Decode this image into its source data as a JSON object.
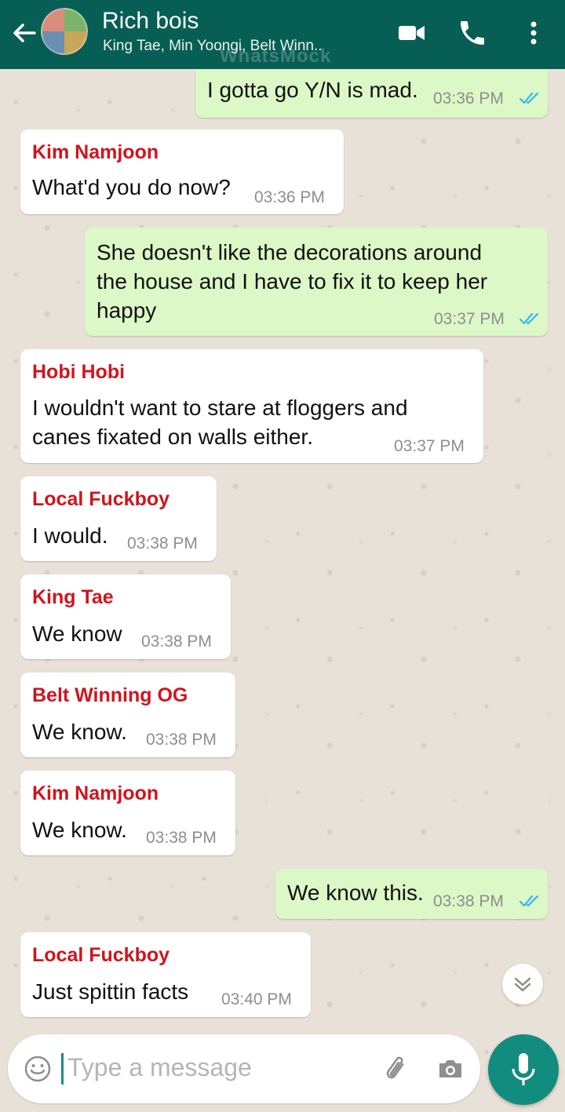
{
  "header": {
    "title": "Rich bois",
    "subtitle": "King Tae, Min Yoongi, Belt Winn..",
    "watermark": "WhatsMock"
  },
  "messages": [
    {
      "dir": "out",
      "text": "I gotta go Y/N is mad.",
      "time": "03:36 PM",
      "read": true
    },
    {
      "dir": "in",
      "sender": "Kim Namjoon",
      "text": "What'd you do now?",
      "time": "03:36 PM"
    },
    {
      "dir": "out",
      "lines": [
        "She doesn't like the decorations around",
        "the house and I have to fix it to keep her",
        "happy"
      ],
      "time": "03:37 PM",
      "read": true
    },
    {
      "dir": "in",
      "sender": "Hobi Hobi",
      "lines": [
        "I wouldn't want to stare at floggers and",
        "canes fixated on walls either."
      ],
      "time": "03:37 PM"
    },
    {
      "dir": "in",
      "sender": "Local Fuckboy",
      "text": "I would.",
      "time": "03:38 PM"
    },
    {
      "dir": "in",
      "sender": "King Tae",
      "text": "We know",
      "time": "03:38 PM"
    },
    {
      "dir": "in",
      "sender": "Belt Winning OG",
      "text": "We know.",
      "time": "03:38 PM"
    },
    {
      "dir": "in",
      "sender": "Kim Namjoon",
      "text": "We know.",
      "time": "03:38 PM"
    },
    {
      "dir": "out",
      "text": "We know this.",
      "time": "03:38 PM",
      "read": true
    },
    {
      "dir": "in",
      "sender": "Local Fuckboy",
      "text": "Just spittin facts",
      "time": "03:40 PM"
    }
  ],
  "composer": {
    "placeholder": "Type a message"
  },
  "colors": {
    "header": "#075e54",
    "outgoing_bubble": "#dcf8c6",
    "incoming_bubble": "#ffffff",
    "sender_name": "#d0141d",
    "read_ticks": "#34b7f1",
    "mic_button": "#128c7e"
  },
  "icons": [
    "back-arrow-icon",
    "video-call-icon",
    "phone-icon",
    "more-vert-icon",
    "double-check-icon",
    "chevron-down-icon",
    "emoji-icon",
    "attach-icon",
    "camera-icon",
    "mic-icon"
  ]
}
